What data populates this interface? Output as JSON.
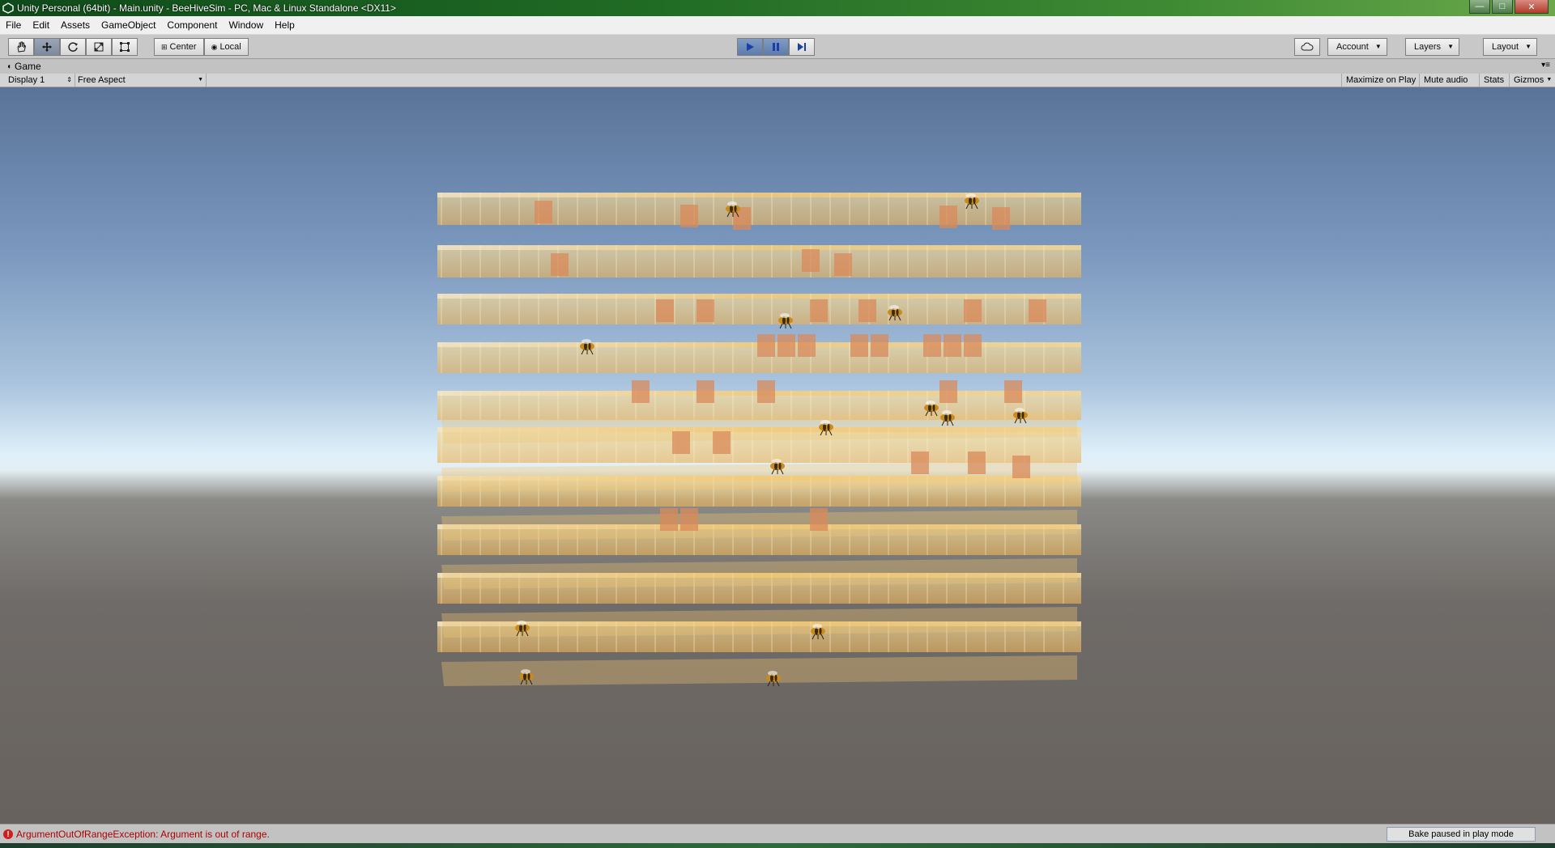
{
  "window": {
    "title": "Unity Personal (64bit) - Main.unity - BeeHiveSim - PC, Mac & Linux Standalone <DX11>",
    "buttons": {
      "minimize": "—",
      "maximize": "□",
      "close": "✕"
    }
  },
  "menu": [
    "File",
    "Edit",
    "Assets",
    "GameObject",
    "Component",
    "Window",
    "Help"
  ],
  "toolbar": {
    "tools": [
      "hand-tool",
      "move-tool",
      "rotate-tool",
      "scale-tool",
      "rect-tool"
    ],
    "active_tool": "move-tool",
    "pivot": "Center",
    "space": "Local",
    "account": "Account",
    "layers": "Layers",
    "layout": "Layout"
  },
  "game_panel": {
    "tab_label": "Game",
    "display": "Display 1",
    "aspect": "Free Aspect",
    "buttons": [
      "Maximize on Play",
      "Mute audio",
      "Stats",
      "Gizmos"
    ]
  },
  "statusbar": {
    "error": "ArgumentOutOfRangeException: Argument is out of range.",
    "bake_status": "Bake paused in play mode"
  },
  "colors": {
    "comb": "#f0c060",
    "comb_highlight": "#fde6a6",
    "brood_cell": "#d98a5a",
    "sky_top": "#5a7398",
    "ground": "#67625e"
  }
}
